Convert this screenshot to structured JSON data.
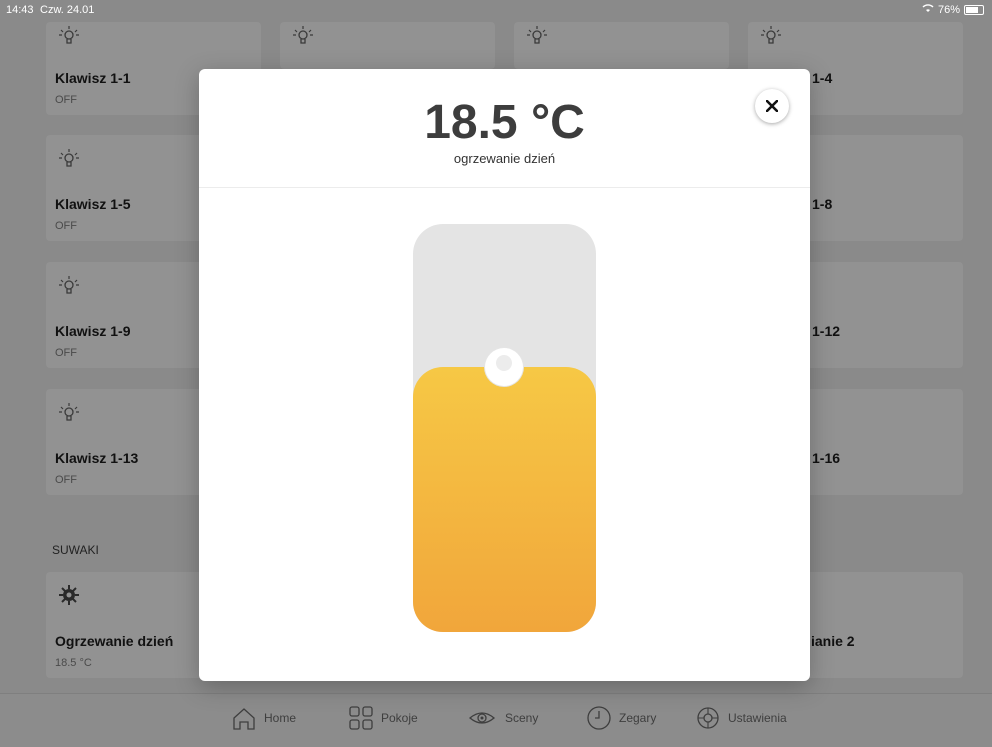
{
  "status_bar": {
    "time": "14:43",
    "date": "Czw. 24.01",
    "wifi_icon": "wifi-icon",
    "battery": "76%"
  },
  "tiles": [
    {
      "icon": "bulb-icon",
      "title": "Klawisz 1-1",
      "state": "OFF"
    },
    {
      "icon": "bulb-icon",
      "title": "",
      "state": ""
    },
    {
      "icon": "bulb-icon",
      "title": "",
      "state": ""
    },
    {
      "icon": "bulb-icon",
      "title": "1-4",
      "state": ""
    },
    {
      "icon": "bulb-icon",
      "title": "Klawisz 1-5",
      "state": "OFF"
    },
    {
      "icon": "",
      "title": "1-8",
      "state": ""
    },
    {
      "icon": "bulb-icon",
      "title": "Klawisz 1-9",
      "state": "OFF"
    },
    {
      "icon": "",
      "title": "1-12",
      "state": ""
    },
    {
      "icon": "bulb-icon",
      "title": "Klawisz 1-13",
      "state": "OFF"
    },
    {
      "icon": "",
      "title": "1-16",
      "state": ""
    },
    {
      "icon": "gear-sun-icon",
      "title": "Ogrzewanie dzień",
      "state": "18.5 °C"
    },
    {
      "icon": "",
      "title": "ianie 2",
      "state": ""
    }
  ],
  "section_label": "SUWAKI",
  "modal": {
    "temperature": "18.5 °C",
    "mode": "ogrzewanie dzień",
    "close_icon": "close-icon",
    "slider_level": 0.65
  },
  "tabbar": [
    {
      "icon": "home-icon",
      "label": "Home"
    },
    {
      "icon": "rooms-icon",
      "label": "Pokoje"
    },
    {
      "icon": "eye-icon",
      "label": "Sceny"
    },
    {
      "icon": "clock-icon",
      "label": "Zegary"
    },
    {
      "icon": "settings-icon",
      "label": "Ustawienia"
    }
  ]
}
